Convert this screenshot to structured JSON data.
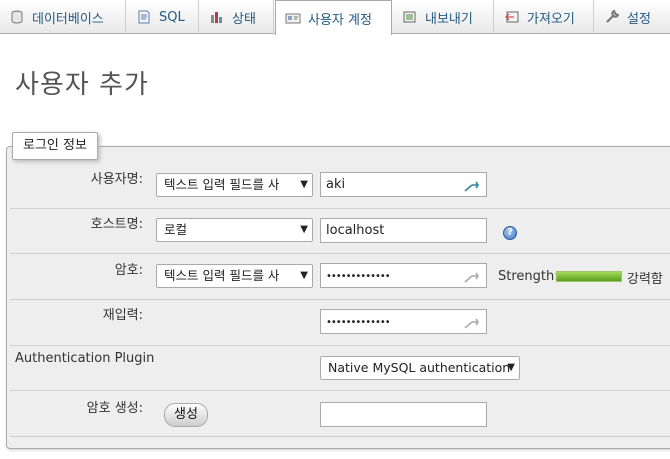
{
  "tabs": [
    {
      "label": "데이터베이스",
      "icon": "database-icon"
    },
    {
      "label": "SQL",
      "icon": "sql-icon"
    },
    {
      "label": "상태",
      "icon": "status-icon"
    },
    {
      "label": "사용자 계정",
      "icon": "user-accounts-icon",
      "active": true
    },
    {
      "label": "내보내기",
      "icon": "export-icon"
    },
    {
      "label": "가져오기",
      "icon": "import-icon"
    },
    {
      "label": "설정",
      "icon": "wrench-icon"
    }
  ],
  "page_title": "사용자 추가",
  "login_info": {
    "legend": "로그인 정보",
    "username": {
      "label": "사용자명:",
      "select": "텍스트 입력 필드를 사",
      "value": "aki"
    },
    "hostname": {
      "label": "호스트명:",
      "select": "로컬",
      "value": "localhost"
    },
    "password": {
      "label": "암호:",
      "select": "텍스트 입력 필드를 사",
      "value": "•••••••••••••"
    },
    "retype": {
      "label": "재입력:",
      "value": "•••••••••••••"
    },
    "auth_plugin": {
      "label": "Authentication Plugin",
      "select": "Native MySQL authentication"
    },
    "generate": {
      "label": "암호 생성:",
      "button": "생성",
      "value": ""
    },
    "strength": {
      "label": "Strength:",
      "text": "강력함",
      "level": 1.0
    }
  },
  "colors": {
    "tab_text": "#235a81",
    "strength_bar": "#6bb32e",
    "fieldset_bg": "#eeeeee"
  }
}
